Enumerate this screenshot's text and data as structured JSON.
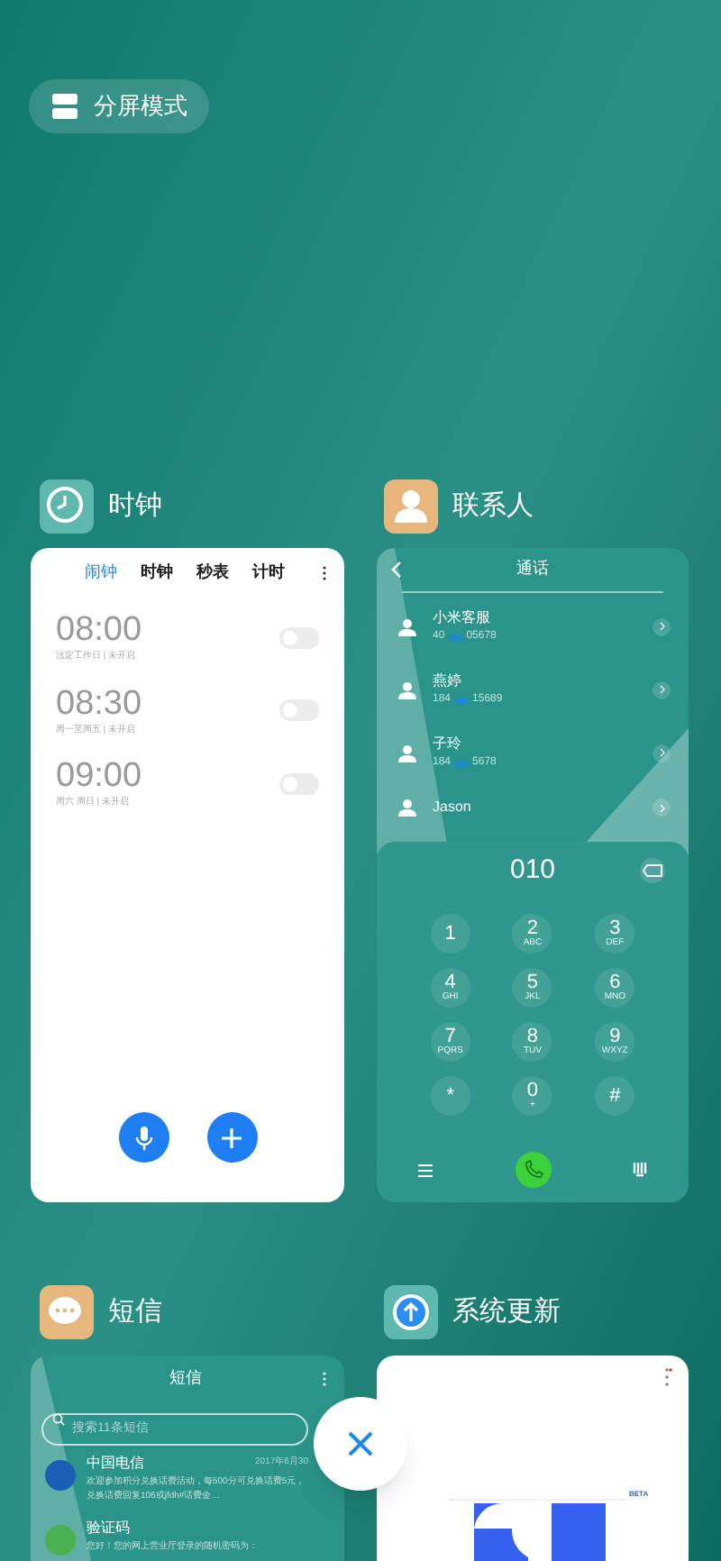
{
  "split_screen_button": {
    "label": "分屏模式"
  },
  "clock": {
    "name": "时钟",
    "tabs": [
      {
        "label": "闹钟",
        "selected": true
      },
      {
        "label": "时钟",
        "selected": false
      },
      {
        "label": "秒表",
        "selected": false
      },
      {
        "label": "计时",
        "selected": false
      }
    ],
    "alarms": [
      {
        "time": "08:00",
        "detail": "法定工作日 | 未开启",
        "on": false
      },
      {
        "time": "08:30",
        "detail": "周一至周五 | 未开启",
        "on": false
      },
      {
        "time": "09:00",
        "detail": "周六 周日 | 未开启",
        "on": false
      }
    ]
  },
  "contacts": {
    "name": "联系人",
    "title": "通话",
    "entries": [
      {
        "name": "小米客服",
        "number_start": "40",
        "number_end": "05678"
      },
      {
        "name": "燕婷",
        "number_start": "184",
        "number_end": "15689"
      },
      {
        "name": "子玲",
        "number_start": "184",
        "number_end": "5678"
      },
      {
        "name": "Jason"
      }
    ],
    "dialed": "010",
    "keys": [
      {
        "digit": "1"
      },
      {
        "digit": "2",
        "letters": "ABC"
      },
      {
        "digit": "3",
        "letters": "DEF"
      },
      {
        "digit": "4",
        "letters": "GHI"
      },
      {
        "digit": "5",
        "letters": "JKL"
      },
      {
        "digit": "6",
        "letters": "MNO"
      },
      {
        "digit": "7",
        "letters": "PQRS"
      },
      {
        "digit": "8",
        "letters": "TUV"
      },
      {
        "digit": "9",
        "letters": "WXYZ"
      },
      {
        "digit": "*"
      },
      {
        "digit": "0",
        "letters": "+"
      },
      {
        "digit": "#"
      }
    ]
  },
  "messages": {
    "name": "短信",
    "title": "短信",
    "search_placeholder": "搜索11条短信",
    "items": [
      {
        "sender": "中国电信",
        "time": "2017年6月30",
        "preview": "欢迎参加积分兑换话费活动，每500分可兑换话费5元，兑换话费回复106或jfdh#话费金…",
        "color": "#1a5fb4"
      },
      {
        "sender": "验证码",
        "preview": "您好！您的网上营业厅登录的随机密码为：",
        "color": "#4caf50"
      }
    ]
  },
  "update": {
    "name": "系统更新",
    "badge": "BETA"
  }
}
